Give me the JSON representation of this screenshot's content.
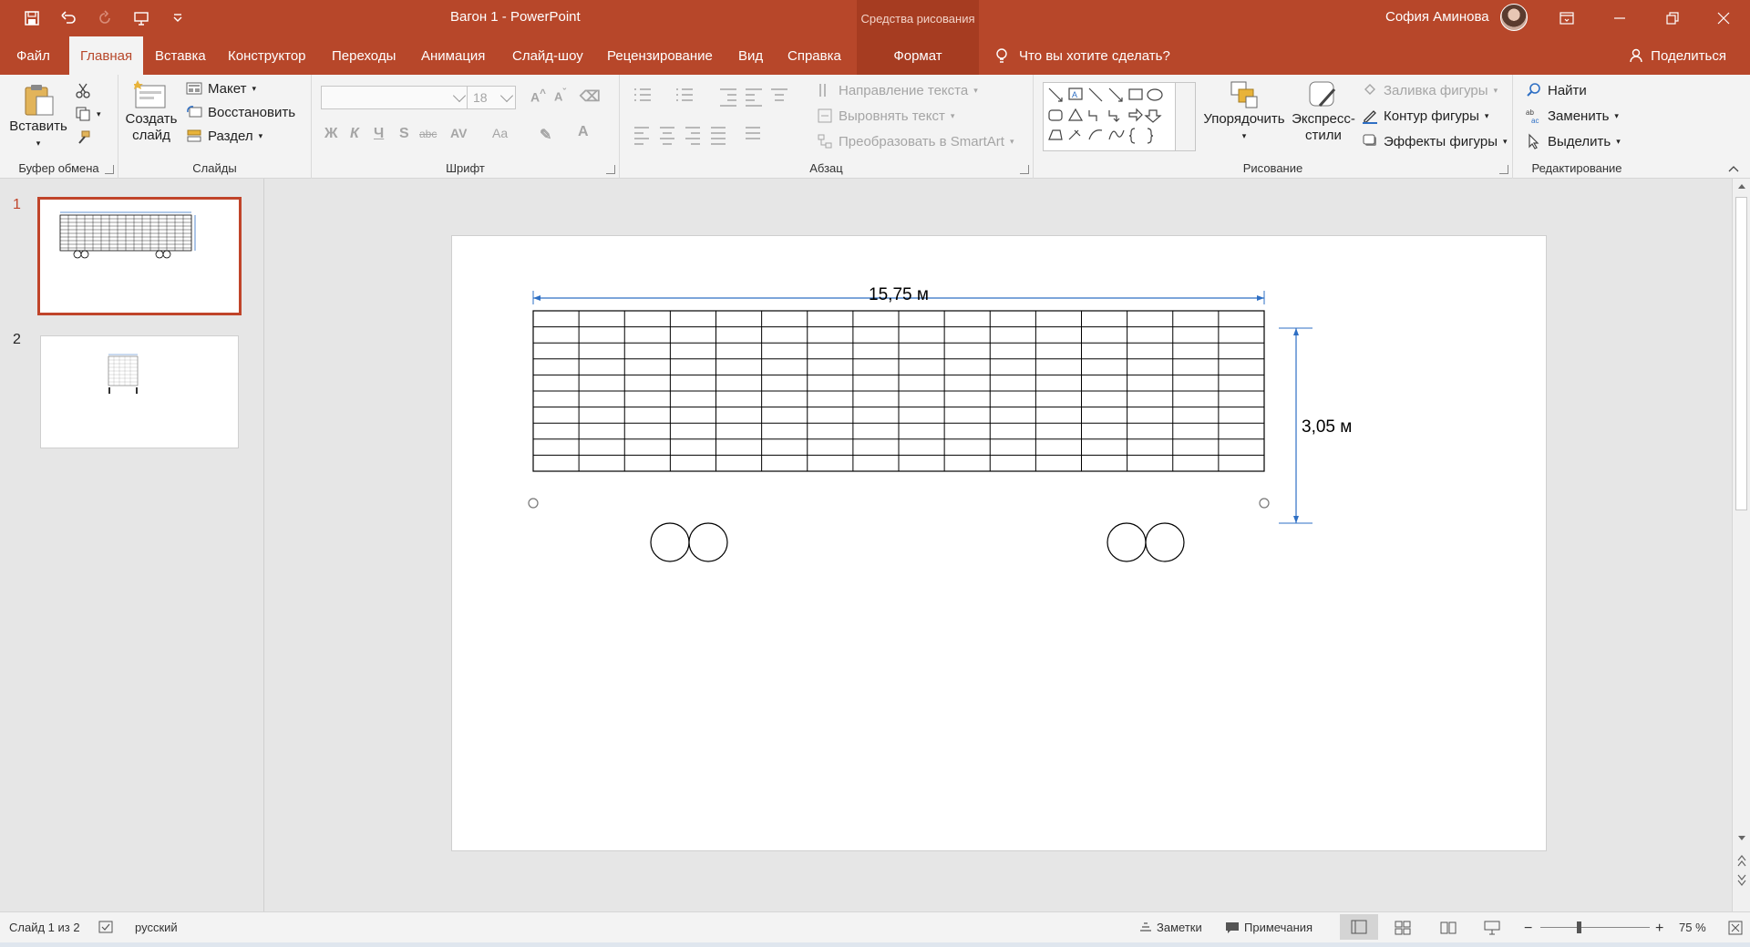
{
  "app": {
    "doc_title": "Вагон 1  -  PowerPoint",
    "context_tools": "Средства рисования",
    "user_name": "София Аминова"
  },
  "tabs": [
    {
      "label": "Файл"
    },
    {
      "label": "Главная"
    },
    {
      "label": "Вставка"
    },
    {
      "label": "Конструктор"
    },
    {
      "label": "Переходы"
    },
    {
      "label": "Анимация"
    },
    {
      "label": "Слайд-шоу"
    },
    {
      "label": "Рецензирование"
    },
    {
      "label": "Вид"
    },
    {
      "label": "Справка"
    },
    {
      "label": "Формат"
    }
  ],
  "tell_me": "Что вы хотите сделать?",
  "share": "Поделиться",
  "ribbon": {
    "clipboard": {
      "paste": "Вставить",
      "label": "Буфер обмена"
    },
    "slides": {
      "new_slide_1": "Создать",
      "new_slide_2": "слайд",
      "layout": "Макет",
      "reset": "Восстановить",
      "section": "Раздел",
      "label": "Слайды"
    },
    "font": {
      "font_size": "18",
      "label": "Шрифт",
      "bold": "Ж",
      "italic": "К",
      "underline": "Ч",
      "shadow": "S",
      "strike": "abc",
      "spacing": "AV",
      "case": "Aa",
      "color": "A"
    },
    "paragraph": {
      "text_direction": "Направление текста",
      "align_text": "Выровнять текст",
      "smartart": "Преобразовать в SmartArt",
      "label": "Абзац"
    },
    "drawing": {
      "arrange": "Упорядочить",
      "quick_styles_1": "Экспресс-",
      "quick_styles_2": "стили",
      "shape_fill": "Заливка фигуры",
      "shape_outline": "Контур фигуры",
      "shape_effects": "Эффекты фигуры",
      "label": "Рисование"
    },
    "editing": {
      "find": "Найти",
      "replace": "Заменить",
      "select": "Выделить",
      "label": "Редактирование"
    }
  },
  "thumbnails": [
    {
      "num": "1",
      "selected": true
    },
    {
      "num": "2",
      "selected": false
    }
  ],
  "slide": {
    "width_label": "15,75 м",
    "height_label": "3,05 м",
    "grid_columns": 16,
    "grid_rows": 10
  },
  "status": {
    "slide_info": "Слайд 1 из 2",
    "language": "русский",
    "notes": "Заметки",
    "comments": "Примечания",
    "zoom": "75 %"
  },
  "colors": {
    "accent": "#b7472a",
    "dimension_line": "#2e6fc4"
  }
}
